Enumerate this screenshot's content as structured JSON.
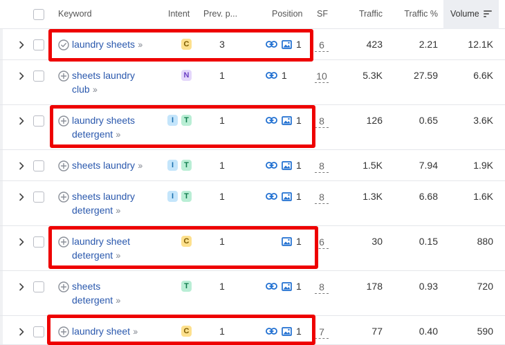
{
  "header": {
    "keyword": "Keyword",
    "intent": "Intent",
    "prev_position": "Prev. p...",
    "position": "Position",
    "sf": "SF",
    "traffic": "Traffic",
    "traffic_pct": "Traffic %",
    "volume": "Volume"
  },
  "rows": [
    {
      "kw1": "laundry sheets",
      "kw2": "",
      "intents": [
        "C"
      ],
      "prev": "3",
      "link": true,
      "image": true,
      "pos": "1",
      "sf": "6",
      "traffic": "423",
      "tpct": "2.21",
      "volume": "12.1K",
      "kw_icon": "check-circle-icon",
      "highlighted": true
    },
    {
      "kw1": "sheets laundry",
      "kw2": "club",
      "intents": [
        "N"
      ],
      "prev": "1",
      "link": true,
      "image": false,
      "pos": "1",
      "sf": "10",
      "traffic": "5.3K",
      "tpct": "27.59",
      "volume": "6.6K",
      "kw_icon": "plus-circle-icon",
      "highlighted": false
    },
    {
      "kw1": "laundry sheets",
      "kw2": "detergent",
      "intents": [
        "I",
        "T"
      ],
      "prev": "1",
      "link": true,
      "image": true,
      "pos": "1",
      "sf": "8",
      "traffic": "126",
      "tpct": "0.65",
      "volume": "3.6K",
      "kw_icon": "plus-circle-icon",
      "highlighted": true
    },
    {
      "kw1": "sheets laundry",
      "kw2": "",
      "intents": [
        "I",
        "T"
      ],
      "prev": "1",
      "link": true,
      "image": true,
      "pos": "1",
      "sf": "8",
      "traffic": "1.5K",
      "tpct": "7.94",
      "volume": "1.9K",
      "kw_icon": "plus-circle-icon",
      "highlighted": false
    },
    {
      "kw1": "sheets laundry",
      "kw2": "detergent",
      "intents": [
        "I",
        "T"
      ],
      "prev": "1",
      "link": true,
      "image": true,
      "pos": "1",
      "sf": "8",
      "traffic": "1.3K",
      "tpct": "6.68",
      "volume": "1.6K",
      "kw_icon": "plus-circle-icon",
      "highlighted": false
    },
    {
      "kw1": "laundry sheet",
      "kw2": "detergent",
      "intents": [
        "C"
      ],
      "prev": "1",
      "link": false,
      "image": true,
      "pos": "1",
      "sf": "6",
      "traffic": "30",
      "tpct": "0.15",
      "volume": "880",
      "kw_icon": "plus-circle-icon",
      "highlighted": true
    },
    {
      "kw1": "sheets",
      "kw2": "detergent",
      "intents": [
        "T"
      ],
      "prev": "1",
      "link": true,
      "image": true,
      "pos": "1",
      "sf": "8",
      "traffic": "178",
      "tpct": "0.93",
      "volume": "720",
      "kw_icon": "plus-circle-icon",
      "highlighted": false
    },
    {
      "kw1": "laundry sheet",
      "kw2": "",
      "intents": [
        "C"
      ],
      "prev": "1",
      "link": true,
      "image": true,
      "pos": "1",
      "sf": "7",
      "traffic": "77",
      "tpct": "0.40",
      "volume": "590",
      "kw_icon": "plus-circle-icon",
      "highlighted": true
    }
  ],
  "colors": {
    "keyword_link": "#2a58ad",
    "highlight_border": "#ee0000",
    "position_icon": "#1f6fd1",
    "badge_commercial": "#fde08d",
    "badge_navigational": "#e4d7fb",
    "badge_informational": "#c4e5fb",
    "badge_transactional": "#b9eed5"
  },
  "icons": {
    "sort": "sort-descending-icon",
    "expand": "chevron-right-icon",
    "link": "link-icon",
    "image": "image-icon",
    "arrows": "double-chevron-right-icon"
  }
}
